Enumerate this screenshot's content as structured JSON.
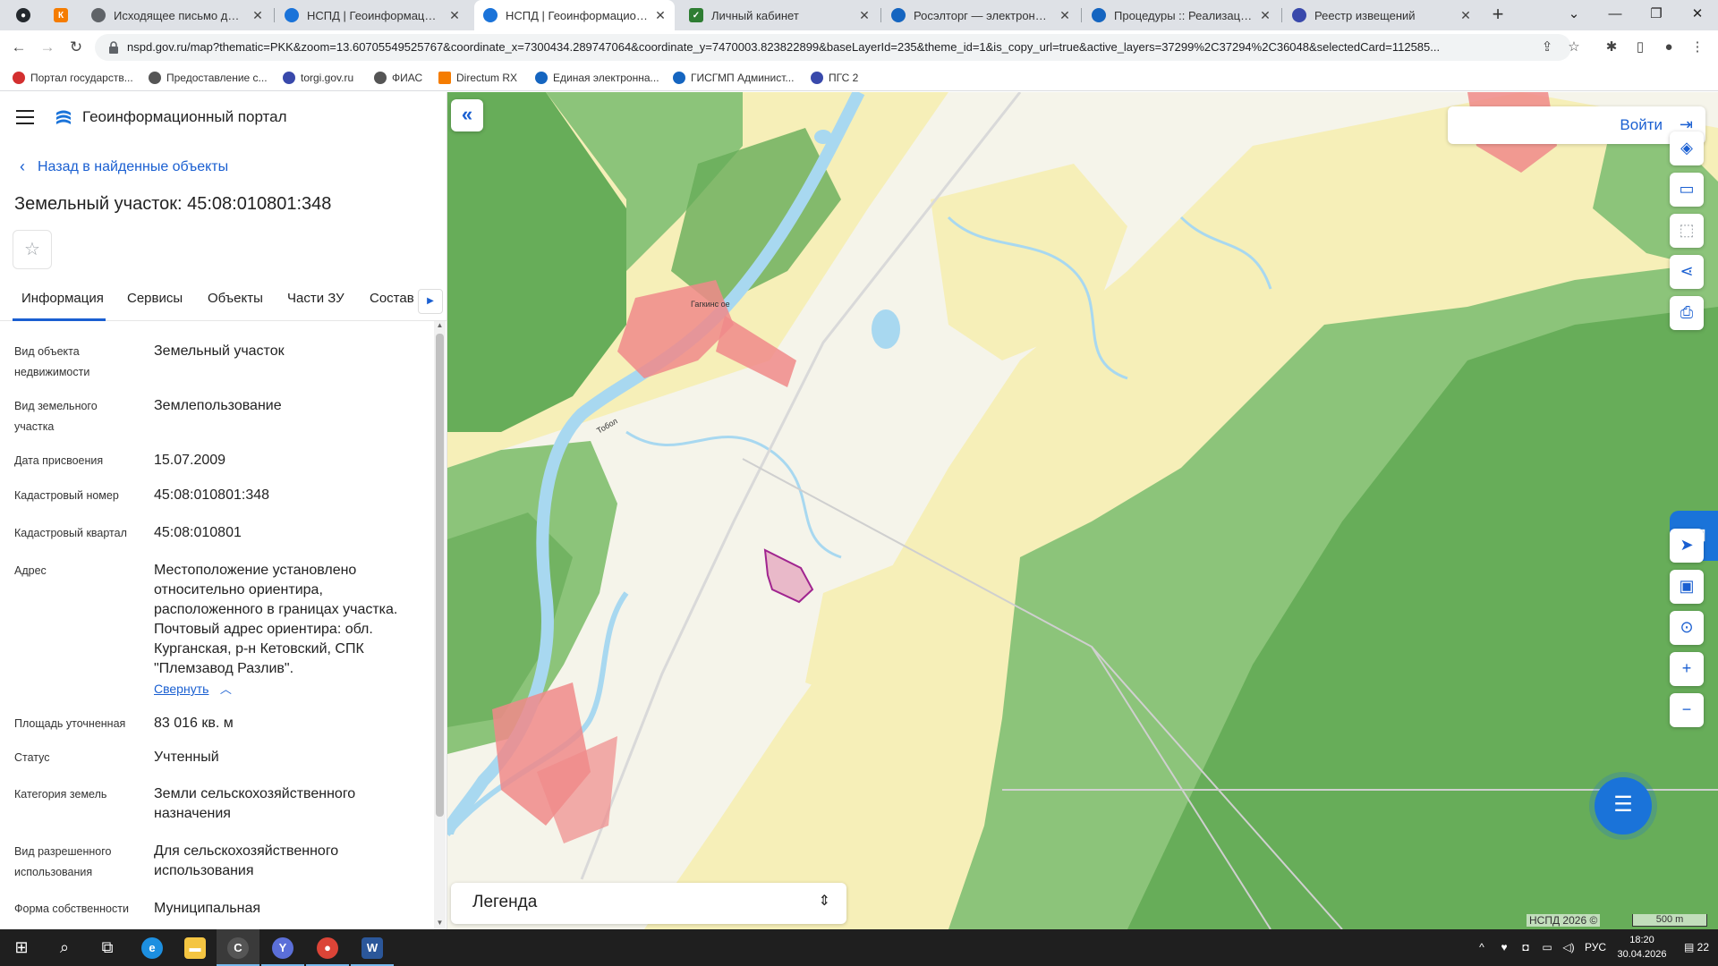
{
  "browser": {
    "tabs": [
      {
        "label": "",
        "icon": "github-icon",
        "color": "#24292e"
      },
      {
        "label": "",
        "icon": "k-icon",
        "color": "#f57c00"
      },
      {
        "label": "Исходящее письмо для ФАС",
        "icon": "globe-icon",
        "color": "#5f6368"
      },
      {
        "label": "НСПД | Геоинформационны",
        "icon": "nspd-icon",
        "color": "#1a73d9"
      },
      {
        "label": "НСПД | Геоинформационны",
        "icon": "nspd-icon",
        "color": "#1a73d9"
      },
      {
        "label": "Личный кабинет",
        "icon": "cabinet-icon",
        "color": "#2e7d32"
      },
      {
        "label": "Росэлторг — электронная то",
        "icon": "roseltorg-icon",
        "color": "#1565c0"
      },
      {
        "label": "Процедуры :: Реализация го",
        "icon": "roseltorg-icon",
        "color": "#1565c0"
      },
      {
        "label": "Реестр извещений",
        "icon": "emblem-icon",
        "color": "#3949ab"
      }
    ],
    "url": "nspd.gov.ru/map?thematic=PKK&zoom=13.60705549525767&coordinate_x=7300434.289747064&coordinate_y=7470003.823822899&baseLayerId=235&theme_id=1&is_copy_url=true&active_layers=37299%2C37294%2C36048&selectedCard=112585...",
    "bookmarks": [
      {
        "label": "Портал государств...",
        "color": "#d32f2f"
      },
      {
        "label": "Предоставление с...",
        "color": "#555555"
      },
      {
        "label": "torgi.gov.ru",
        "color": "#3949ab"
      },
      {
        "label": "ФИАС",
        "color": "#555555"
      },
      {
        "label": "Directum RX",
        "color": "#f57c00"
      },
      {
        "label": "Единая электронна...",
        "color": "#1565c0"
      },
      {
        "label": "ГИСГМП Админист...",
        "color": "#1565c0"
      },
      {
        "label": "ПГС 2",
        "color": "#3949ab"
      }
    ]
  },
  "portal": {
    "title": "Геоинформационный портал",
    "back_link": "Назад в найденные объекты",
    "object_title": "Земельный участок: 45:08:010801:348",
    "tabs": [
      "Информация",
      "Сервисы",
      "Объекты",
      "Части ЗУ",
      "Состав"
    ],
    "active_tab": "Информация",
    "properties": [
      {
        "label": "Вид объекта недвижимости",
        "value": "Земельный участок"
      },
      {
        "label": "Вид земельного участка",
        "value": "Землепользование"
      },
      {
        "label": "Дата присвоения",
        "value": "15.07.2009"
      },
      {
        "label": "Кадастровый номер",
        "value": "45:08:010801:348"
      },
      {
        "label": "Кадастровый квартал",
        "value": "45:08:010801"
      },
      {
        "label": "Адрес",
        "value": "Местоположение установлено относительно ориентира, расположенного в границах участка. Почтовый адрес ориентира: обл. Курганская, р-н Кетовский, СПК \"Племзавод Разлив\"."
      },
      {
        "label": "Площадь уточненная",
        "value": "83 016 кв. м"
      },
      {
        "label": "Статус",
        "value": "Учтенный"
      },
      {
        "label": "Категория земель",
        "value": "Земли сельскохозяйственного назначения"
      },
      {
        "label": "Вид разрешенного использования",
        "value": "Для сельскохозяйственного использования"
      },
      {
        "label": "Форма собственности",
        "value": "Муниципальная"
      }
    ],
    "collapse_link": "Свернуть"
  },
  "map": {
    "login_label": "Войти",
    "legend_label": "Легенда",
    "copyright": "НСПД 2026 ©",
    "scale": "500 m",
    "river_label": "Тобол",
    "village_label": "Гагкинс ое",
    "colors": {
      "accent": "#1a5fd1",
      "parcel": "#a0248f",
      "forest": "#8cc47a",
      "forest_dark": "#67ad59",
      "field": "#f6efb8",
      "water": "#a8d8f0",
      "settlement": "#f08a8a"
    }
  },
  "taskbar": {
    "time": "18:20",
    "date": "30.04.2026",
    "lang": "РУС",
    "notifications": "22"
  }
}
